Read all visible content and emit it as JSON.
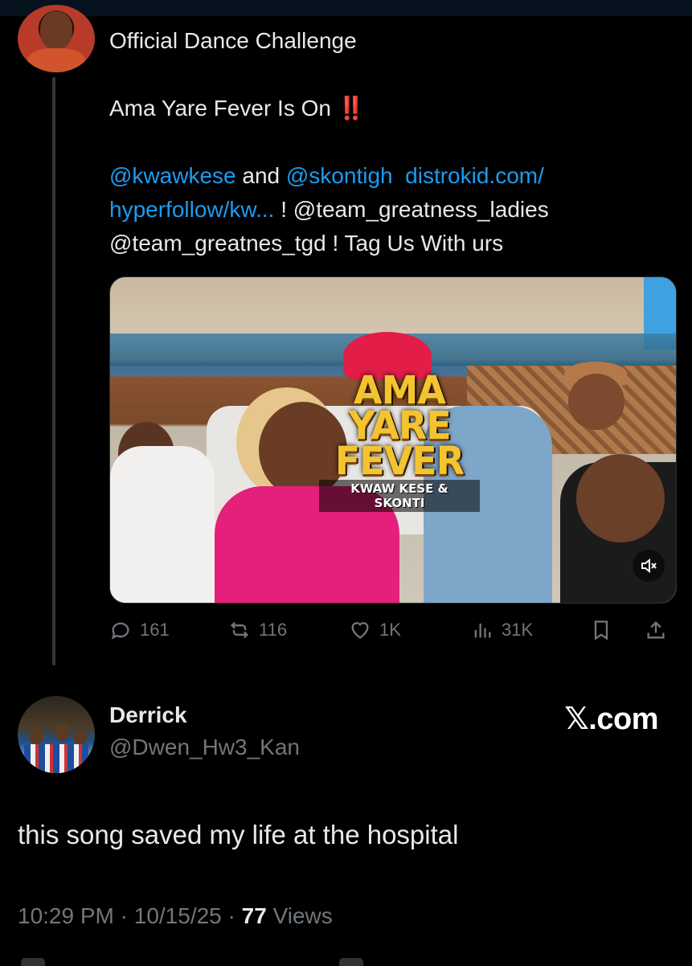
{
  "parent_post": {
    "heading": "Official Dance Challenge",
    "line2": "Ama Yare Fever  Is On",
    "line2_emoji": "‼️",
    "mention1": "@kwawkese",
    "and": "and",
    "mention2": "@skontigh",
    "link_part1": "distrokid.com/",
    "link_part2": "hyperfollow/kw...",
    "sep": "!",
    "mention3": "@team_greatness_ladies",
    "mention4": "@team_greatnes_tgd",
    "closing": "! Tag Us With urs",
    "media": {
      "title_lines": [
        "AMA",
        "YARE",
        "FEVER"
      ],
      "subtitle": "KWAW KESE & SKONTI",
      "mute_icon": "speaker-muted-icon"
    },
    "actions": {
      "replies": "161",
      "reposts": "116",
      "likes": "1K",
      "views": "31K"
    }
  },
  "reply_post": {
    "name": "Derrick",
    "handle": "@Dwen_Hw3_Kan",
    "watermark": "𝕏.com",
    "text": "this song saved my life at the hospital",
    "time": "10:29 PM",
    "date": "10/15/25",
    "dot": "·",
    "views_count": "77",
    "views_label": "Views"
  },
  "colors": {
    "background": "#000000",
    "text": "#e7e9ea",
    "muted": "#71767b",
    "link": "#1d9bf0",
    "emoji_red": "#e0241b"
  }
}
